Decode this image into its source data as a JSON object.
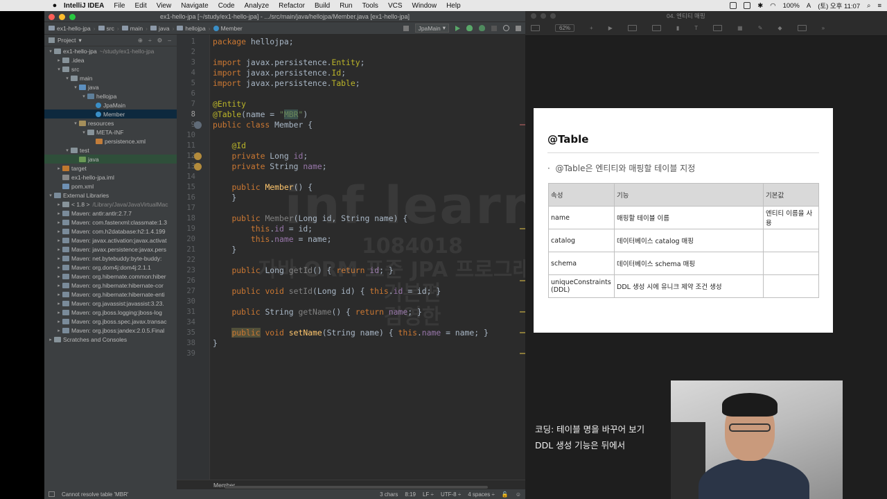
{
  "menubar": {
    "app": "IntelliJ IDEA",
    "items": [
      "File",
      "Edit",
      "View",
      "Navigate",
      "Code",
      "Analyze",
      "Refactor",
      "Build",
      "Run",
      "Tools",
      "VCS",
      "Window",
      "Help"
    ],
    "battery": "100%",
    "clock": "(토) 오후 11:07"
  },
  "ide": {
    "title": "ex1-hello-jpa [~/study/ex1-hello-jpa] - .../src/main/java/hellojpa/Member.java [ex1-hello-jpa]",
    "breadcrumbs": [
      "ex1-hello-jpa",
      "src",
      "main",
      "java",
      "hellojpa",
      "Member"
    ],
    "run_config": "JpaMain",
    "project_header": "Project",
    "tree": [
      {
        "label": "ex1-hello-jpa",
        "extra": "~/study/ex1-hello-jpa",
        "depth": 0,
        "arrow": "▾",
        "icon": "folder"
      },
      {
        "label": ".idea",
        "depth": 1,
        "arrow": "▸",
        "icon": "folder"
      },
      {
        "label": "src",
        "depth": 1,
        "arrow": "▾",
        "icon": "folder"
      },
      {
        "label": "main",
        "depth": 2,
        "arrow": "▾",
        "icon": "folder"
      },
      {
        "label": "java",
        "depth": 3,
        "arrow": "▾",
        "icon": "src"
      },
      {
        "label": "hellojpa",
        "depth": 4,
        "arrow": "▾",
        "icon": "pkg"
      },
      {
        "label": "JpaMain",
        "depth": 5,
        "arrow": "",
        "icon": "cls"
      },
      {
        "label": "Member",
        "depth": 5,
        "arrow": "",
        "icon": "cls",
        "selected": true
      },
      {
        "label": "resources",
        "depth": 3,
        "arrow": "▾",
        "icon": "res"
      },
      {
        "label": "META-INF",
        "depth": 4,
        "arrow": "▾",
        "icon": "folder"
      },
      {
        "label": "persistence.xml",
        "depth": 5,
        "arrow": "",
        "icon": "xml"
      },
      {
        "label": "test",
        "depth": 2,
        "arrow": "▾",
        "icon": "folder"
      },
      {
        "label": "java",
        "depth": 3,
        "arrow": "",
        "icon": "test",
        "highlight": true
      },
      {
        "label": "target",
        "depth": 1,
        "arrow": "▸",
        "icon": "target"
      },
      {
        "label": "ex1-hello-jpa.iml",
        "depth": 1,
        "arrow": "",
        "icon": "iml"
      },
      {
        "label": "pom.xml",
        "depth": 1,
        "arrow": "",
        "icon": "mvn"
      },
      {
        "label": "External Libraries",
        "depth": 0,
        "arrow": "▾",
        "icon": "lib"
      },
      {
        "label": "< 1.8 >",
        "extra": "/Library/Java/JavaVirtualMac",
        "depth": 1,
        "arrow": "▸",
        "icon": "folder"
      },
      {
        "label": "Maven: antlr:antlr:2.7.7",
        "depth": 1,
        "arrow": "▸",
        "icon": "lib"
      },
      {
        "label": "Maven: com.fasterxml:classmate:1.3",
        "depth": 1,
        "arrow": "▸",
        "icon": "lib"
      },
      {
        "label": "Maven: com.h2database:h2:1.4.199",
        "depth": 1,
        "arrow": "▸",
        "icon": "lib"
      },
      {
        "label": "Maven: javax.activation:javax.activat",
        "depth": 1,
        "arrow": "▸",
        "icon": "lib"
      },
      {
        "label": "Maven: javax.persistence:javax.pers",
        "depth": 1,
        "arrow": "▸",
        "icon": "lib"
      },
      {
        "label": "Maven: net.bytebuddy:byte-buddy:",
        "depth": 1,
        "arrow": "▸",
        "icon": "lib"
      },
      {
        "label": "Maven: org.dom4j:dom4j:2.1.1",
        "depth": 1,
        "arrow": "▸",
        "icon": "lib"
      },
      {
        "label": "Maven: org.hibernate.common:hiber",
        "depth": 1,
        "arrow": "▸",
        "icon": "lib"
      },
      {
        "label": "Maven: org.hibernate:hibernate-cor",
        "depth": 1,
        "arrow": "▸",
        "icon": "lib"
      },
      {
        "label": "Maven: org.hibernate:hibernate-enti",
        "depth": 1,
        "arrow": "▸",
        "icon": "lib"
      },
      {
        "label": "Maven: org.javassist:javassist:3.23.",
        "depth": 1,
        "arrow": "▸",
        "icon": "lib"
      },
      {
        "label": "Maven: org.jboss.logging:jboss-log",
        "depth": 1,
        "arrow": "▸",
        "icon": "lib"
      },
      {
        "label": "Maven: org.jboss.spec.javax.transac",
        "depth": 1,
        "arrow": "▸",
        "icon": "lib"
      },
      {
        "label": "Maven: org.jboss:jandex:2.0.5.Final",
        "depth": 1,
        "arrow": "▸",
        "icon": "lib"
      },
      {
        "label": "Scratches and Consoles",
        "depth": 0,
        "arrow": "▸",
        "icon": "folder"
      }
    ],
    "line_numbers": [
      "1",
      "2",
      "3",
      "4",
      "5",
      "6",
      "7",
      "8",
      "9",
      "10",
      "11",
      "12",
      "13",
      "14",
      "15",
      "16",
      "17",
      "18",
      "19",
      "20",
      "21",
      "22",
      "23",
      "26",
      "27",
      "30",
      "31",
      "34",
      "35",
      "38",
      "39"
    ],
    "current_line": "8",
    "code_lines": [
      {
        "line": "1",
        "html": "<span class='kw'>package</span> hellojpa;"
      },
      {
        "line": "3",
        "html": "<span class='kw'>import</span> javax.persistence.<span class='an'>Entity</span>;"
      },
      {
        "line": "4",
        "html": "<span class='kw'>import</span> javax.persistence.<span class='an'>Id</span>;"
      },
      {
        "line": "5",
        "html": "<span class='kw'>import</span> javax.persistence.<span class='an'>Table</span>;"
      },
      {
        "line": "7",
        "html": "<span class='an'>@Entity</span>"
      },
      {
        "line": "8",
        "html": "<span class='an'>@Table</span>(name = <span class='str'>\"<span class='mbr-hl'>MBR</span>\"</span>)"
      },
      {
        "line": "9",
        "html": "<span class='kw'>public class</span> Member {"
      },
      {
        "line": "11",
        "html": "    <span class='an'>@Id</span>"
      },
      {
        "line": "12",
        "html": "    <span class='kw'>private</span> Long <span class='fld'>id</span>;"
      },
      {
        "line": "13",
        "html": "    <span class='kw'>private</span> String <span class='fld'>name</span>;"
      },
      {
        "line": "15",
        "html": "    <span class='kw'>public</span> <span class='fn'>Member</span>() {"
      },
      {
        "line": "16",
        "html": "    }"
      },
      {
        "line": "18",
        "html": "    <span class='kw'>public</span> <span class='gry'>Member</span>(Long id, String name) {"
      },
      {
        "line": "19",
        "html": "        <span class='kw'>this</span>.<span class='fld'>id</span> = id;"
      },
      {
        "line": "20",
        "html": "        <span class='kw'>this</span>.<span class='fld'>name</span> = name;"
      },
      {
        "line": "21",
        "html": "    }"
      },
      {
        "line": "23",
        "html": "    <span class='kw'>public</span> Long <span class='gry'>getId</span>() { <span class='kw'>return</span> <span class='fld'>id</span>; }"
      },
      {
        "line": "27",
        "html": "    <span class='kw'>public void</span> <span class='gry'>setId</span>(Long id) { <span class='kw'>this</span>.<span class='fld'>id</span> = id; }"
      },
      {
        "line": "31",
        "html": "    <span class='kw'>public</span> String <span class='gry'>getName</span>() { <span class='kw'>return</span> <span class='fld'>name</span>; }"
      },
      {
        "line": "35",
        "html": "    <span class='kw pub-hl'>public</span> <span class='kw'>void</span> <span class='fn'>setName</span>(String name) { <span class='kw'>this</span>.<span class='fld'>name</span> = name; }"
      },
      {
        "line": "38",
        "html": "}"
      }
    ],
    "editor_footer": "Member",
    "status_message": "Cannot resolve table 'MBR'",
    "status_right": [
      "3 chars",
      "8:19",
      "LF ÷",
      "UTF-8 ÷",
      "4 spaces ÷"
    ]
  },
  "watermark": {
    "brand": "inf learn",
    "id": "1084018",
    "course": "자바 ORM 표준 JPA 프로그래밍 - 기본편",
    "author": "김영한"
  },
  "keynote": {
    "window_title": "04. 엔티티 매핑",
    "zoom": "62%",
    "slide": {
      "title": "@Table",
      "bullet": "@Table은 엔티티와 매핑할 테이블 지정",
      "columns": [
        "속성",
        "기능",
        "기본값"
      ],
      "rows": [
        [
          "name",
          "매핑할 테이블 이름",
          "엔티티 이름을 사용"
        ],
        [
          "catalog",
          "데이터베이스 catalog 매핑",
          ""
        ],
        [
          "schema",
          "데이터베이스 schema 매핑",
          ""
        ],
        [
          "uniqueConstraints (DDL)",
          "DDL 생성 시에 유니크 제약 조건 생성",
          ""
        ]
      ]
    },
    "caption": [
      "코딩: 테이블 명을 바꾸어 보기",
      "DDL 생성 기능은 뒤에서"
    ]
  }
}
